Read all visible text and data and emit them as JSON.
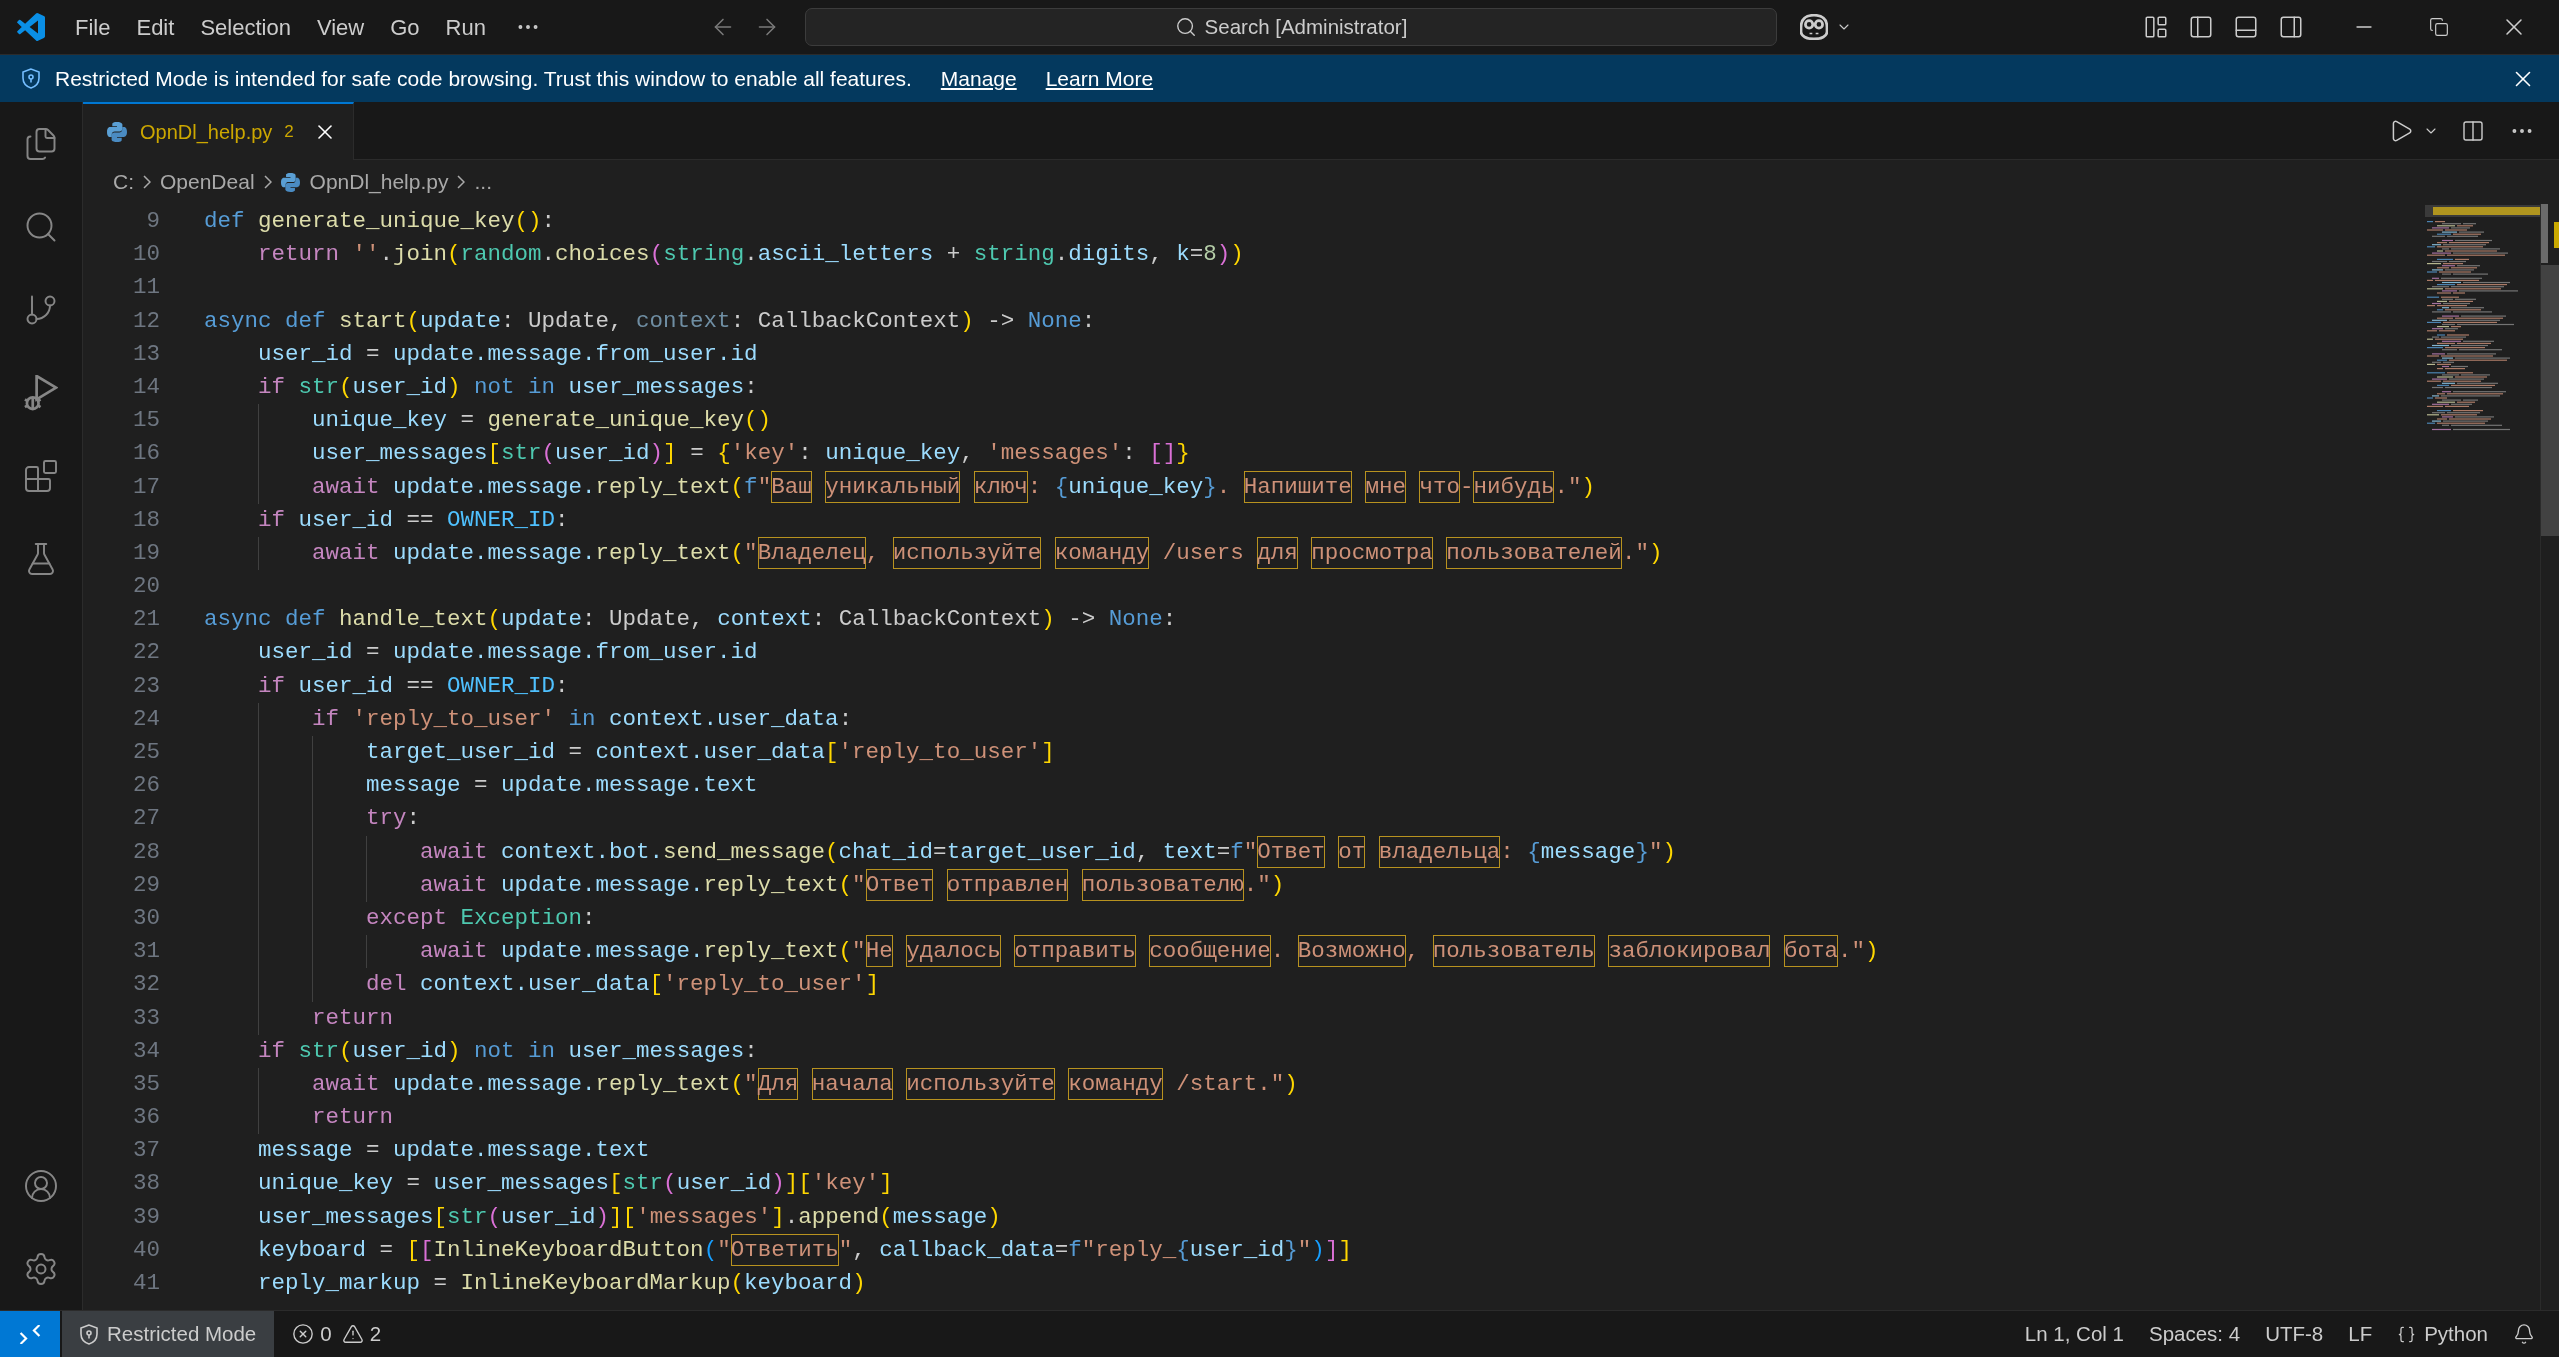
{
  "title_bar": {
    "menu": [
      "File",
      "Edit",
      "Selection",
      "View",
      "Go",
      "Run"
    ],
    "command_center": "Search [Administrator]"
  },
  "banner": {
    "message": "Restricted Mode is intended for safe code browsing. Trust this window to enable all features.",
    "links": [
      "Manage",
      "Learn More"
    ]
  },
  "tabs": [
    {
      "label": "OpnDl_help.py",
      "problems": "2",
      "selected": true
    }
  ],
  "breadcrumb": [
    {
      "label": "C:",
      "kind": "folder"
    },
    {
      "label": "OpenDeal",
      "kind": "folder"
    },
    {
      "label": "OpnDl_help.py",
      "kind": "file"
    },
    {
      "label": "...",
      "kind": "more"
    }
  ],
  "editor": {
    "lines": [
      {
        "number": "9",
        "tokens": [
          {
            "text": "def ",
            "kind": "keyword"
          },
          {
            "text": "generate_unique_key",
            "kind": "function"
          },
          {
            "text": "()",
            "kind": "bracket1"
          },
          {
            "text": ":",
            "kind": "plain"
          }
        ],
        "children": [
          {
            "number": "10",
            "tokens": [
              {
                "text": "return ",
                "kind": "control"
              },
              {
                "text": "''",
                "kind": "string"
              },
              {
                "text": ".",
                "kind": "plain"
              },
              {
                "text": "join",
                "kind": "function"
              },
              {
                "text": "(",
                "kind": "bracket1"
              },
              {
                "text": "random",
                "kind": "class"
              },
              {
                "text": ".",
                "kind": "plain"
              },
              {
                "text": "choices",
                "kind": "function"
              },
              {
                "text": "(",
                "kind": "bracket2"
              },
              {
                "text": "string",
                "kind": "class"
              },
              {
                "text": ".",
                "kind": "plain"
              },
              {
                "text": "ascii_letters",
                "kind": "variable"
              },
              {
                "text": " + ",
                "kind": "plain"
              },
              {
                "text": "string",
                "kind": "class"
              },
              {
                "text": ".",
                "kind": "plain"
              },
              {
                "text": "digits",
                "kind": "variable"
              },
              {
                "text": ", ",
                "kind": "plain"
              },
              {
                "text": "k",
                "kind": "variable"
              },
              {
                "text": "=",
                "kind": "plain"
              },
              {
                "text": "8",
                "kind": "number"
              },
              {
                "text": ")",
                "kind": "bracket2"
              },
              {
                "text": ")",
                "kind": "bracket1"
              }
            ]
          }
        ]
      },
      {
        "number": "11"
      },
      {
        "number": "12",
        "tokens": [
          {
            "text": "async def ",
            "kind": "keyword"
          },
          {
            "text": "start",
            "kind": "function"
          },
          {
            "text": "(",
            "kind": "bracket1"
          },
          {
            "text": "update",
            "kind": "variable"
          },
          {
            "text": ": Update, ",
            "kind": "plain"
          },
          {
            "text": "context",
            "kind": "unused"
          },
          {
            "text": ": CallbackContext",
            "kind": "plain"
          },
          {
            "text": ")",
            "kind": "bracket1"
          },
          {
            "text": " -> ",
            "kind": "plain"
          },
          {
            "text": "None",
            "kind": "keyword"
          },
          {
            "text": ":",
            "kind": "plain"
          }
        ],
        "children": [
          {
            "number": "13",
            "tokens": [
              {
                "text": "user_id",
                "kind": "variable"
              },
              {
                "text": " = ",
                "kind": "plain"
              },
              {
                "text": "update.message.from_user.id",
                "kind": "variable"
              }
            ]
          },
          {
            "number": "14",
            "tokens": [
              {
                "text": "if ",
                "kind": "control"
              },
              {
                "text": "str",
                "kind": "class"
              },
              {
                "text": "(",
                "kind": "bracket1"
              },
              {
                "text": "user_id",
                "kind": "variable"
              },
              {
                "text": ")",
                "kind": "bracket1"
              },
              {
                "text": " not in ",
                "kind": "keyword"
              },
              {
                "text": "user_messages",
                "kind": "variable"
              },
              {
                "text": ":",
                "kind": "plain"
              }
            ],
            "children": [
              {
                "number": "15",
                "tokens": [
                  {
                    "text": "unique_key",
                    "kind": "variable"
                  },
                  {
                    "text": " = ",
                    "kind": "plain"
                  },
                  {
                    "text": "generate_unique_key",
                    "kind": "function"
                  },
                  {
                    "text": "()",
                    "kind": "bracket1"
                  }
                ]
              },
              {
                "number": "16",
                "tokens": [
                  {
                    "text": "user_messages",
                    "kind": "variable"
                  },
                  {
                    "text": "[",
                    "kind": "bracket1"
                  },
                  {
                    "text": "str",
                    "kind": "class"
                  },
                  {
                    "text": "(",
                    "kind": "bracket2"
                  },
                  {
                    "text": "user_id",
                    "kind": "variable"
                  },
                  {
                    "text": ")",
                    "kind": "bracket2"
                  },
                  {
                    "text": "]",
                    "kind": "bracket1"
                  },
                  {
                    "text": " = ",
                    "kind": "plain"
                  },
                  {
                    "text": "{",
                    "kind": "bracket1"
                  },
                  {
                    "text": "'key'",
                    "kind": "string"
                  },
                  {
                    "text": ": ",
                    "kind": "plain"
                  },
                  {
                    "text": "unique_key",
                    "kind": "variable"
                  },
                  {
                    "text": ", ",
                    "kind": "plain"
                  },
                  {
                    "text": "'messages'",
                    "kind": "string"
                  },
                  {
                    "text": ": ",
                    "kind": "plain"
                  },
                  {
                    "text": "[]",
                    "kind": "bracket2"
                  },
                  {
                    "text": "}",
                    "kind": "bracket1"
                  }
                ]
              },
              {
                "number": "17",
                "tokens": [
                  {
                    "text": "await ",
                    "kind": "control"
                  },
                  {
                    "text": "update.message.",
                    "kind": "variable"
                  },
                  {
                    "text": "reply_text",
                    "kind": "function"
                  },
                  {
                    "text": "(",
                    "kind": "bracket1"
                  },
                  {
                    "text": "f",
                    "kind": "keyword"
                  },
                  {
                    "text": "\"",
                    "kind": "string"
                  },
                  {
                    "text": "Ваш уникальный ключ",
                    "kind": "flagged"
                  },
                  {
                    "text": ": ",
                    "kind": "string"
                  },
                  {
                    "text": "{",
                    "kind": "keyword"
                  },
                  {
                    "text": "unique_key",
                    "kind": "variable"
                  },
                  {
                    "text": "}",
                    "kind": "keyword"
                  },
                  {
                    "text": ". ",
                    "kind": "string"
                  },
                  {
                    "text": "Напишите мне что",
                    "kind": "flagged"
                  },
                  {
                    "text": "-",
                    "kind": "string"
                  },
                  {
                    "text": "нибудь",
                    "kind": "flagged"
                  },
                  {
                    "text": ".\"",
                    "kind": "string"
                  },
                  {
                    "text": ")",
                    "kind": "bracket1"
                  }
                ]
              }
            ]
          },
          {
            "number": "18",
            "tokens": [
              {
                "text": "if ",
                "kind": "control"
              },
              {
                "text": "user_id",
                "kind": "variable"
              },
              {
                "text": " == ",
                "kind": "plain"
              },
              {
                "text": "OWNER_ID",
                "kind": "constant"
              },
              {
                "text": ":",
                "kind": "plain"
              }
            ],
            "children": [
              {
                "number": "19",
                "tokens": [
                  {
                    "text": "await ",
                    "kind": "control"
                  },
                  {
                    "text": "update.message.",
                    "kind": "variable"
                  },
                  {
                    "text": "reply_text",
                    "kind": "function"
                  },
                  {
                    "text": "(",
                    "kind": "bracket1"
                  },
                  {
                    "text": "\"",
                    "kind": "string"
                  },
                  {
                    "text": "Владелец",
                    "kind": "flagged"
                  },
                  {
                    "text": ", ",
                    "kind": "string"
                  },
                  {
                    "text": "используйте команду",
                    "kind": "flagged"
                  },
                  {
                    "text": " /users ",
                    "kind": "string"
                  },
                  {
                    "text": "для просмотра пользователей",
                    "kind": "flagged"
                  },
                  {
                    "text": ".\"",
                    "kind": "string"
                  },
                  {
                    "text": ")",
                    "kind": "bracket1"
                  }
                ]
              }
            ]
          }
        ]
      },
      {
        "number": "20"
      },
      {
        "number": "21",
        "tokens": [
          {
            "text": "async def ",
            "kind": "keyword"
          },
          {
            "text": "handle_text",
            "kind": "function"
          },
          {
            "text": "(",
            "kind": "bracket1"
          },
          {
            "text": "update",
            "kind": "variable"
          },
          {
            "text": ": Update, ",
            "kind": "plain"
          },
          {
            "text": "context",
            "kind": "variable"
          },
          {
            "text": ": CallbackContext",
            "kind": "plain"
          },
          {
            "text": ")",
            "kind": "bracket1"
          },
          {
            "text": " -> ",
            "kind": "plain"
          },
          {
            "text": "None",
            "kind": "keyword"
          },
          {
            "text": ":",
            "kind": "plain"
          }
        ],
        "children": [
          {
            "number": "22",
            "tokens": [
              {
                "text": "user_id",
                "kind": "variable"
              },
              {
                "text": " = ",
                "kind": "plain"
              },
              {
                "text": "update.message.from_user.id",
                "kind": "variable"
              }
            ]
          },
          {
            "number": "23",
            "tokens": [
              {
                "text": "if ",
                "kind": "control"
              },
              {
                "text": "user_id",
                "kind": "variable"
              },
              {
                "text": " == ",
                "kind": "plain"
              },
              {
                "text": "OWNER_ID",
                "kind": "constant"
              },
              {
                "text": ":",
                "kind": "plain"
              }
            ],
            "children": [
              {
                "number": "24",
                "tokens": [
                  {
                    "text": "if ",
                    "kind": "control"
                  },
                  {
                    "text": "'reply_to_user'",
                    "kind": "string"
                  },
                  {
                    "text": " in ",
                    "kind": "keyword"
                  },
                  {
                    "text": "context.user_data",
                    "kind": "variable"
                  },
                  {
                    "text": ":",
                    "kind": "plain"
                  }
                ],
                "children": [
                  {
                    "number": "25",
                    "tokens": [
                      {
                        "text": "target_user_id",
                        "kind": "variable"
                      },
                      {
                        "text": " = ",
                        "kind": "plain"
                      },
                      {
                        "text": "context.user_data",
                        "kind": "variable"
                      },
                      {
                        "text": "[",
                        "kind": "bracket1"
                      },
                      {
                        "text": "'reply_to_user'",
                        "kind": "string"
                      },
                      {
                        "text": "]",
                        "kind": "bracket1"
                      }
                    ]
                  },
                  {
                    "number": "26",
                    "tokens": [
                      {
                        "text": "message",
                        "kind": "variable"
                      },
                      {
                        "text": " = ",
                        "kind": "plain"
                      },
                      {
                        "text": "update.message.text",
                        "kind": "variable"
                      }
                    ]
                  },
                  {
                    "number": "27",
                    "tokens": [
                      {
                        "text": "try",
                        "kind": "control"
                      },
                      {
                        "text": ":",
                        "kind": "plain"
                      }
                    ],
                    "children": [
                      {
                        "number": "28",
                        "tokens": [
                          {
                            "text": "await ",
                            "kind": "control"
                          },
                          {
                            "text": "context.bot.",
                            "kind": "variable"
                          },
                          {
                            "text": "send_message",
                            "kind": "function"
                          },
                          {
                            "text": "(",
                            "kind": "bracket1"
                          },
                          {
                            "text": "chat_id",
                            "kind": "variable"
                          },
                          {
                            "text": "=",
                            "kind": "plain"
                          },
                          {
                            "text": "target_user_id",
                            "kind": "variable"
                          },
                          {
                            "text": ", ",
                            "kind": "plain"
                          },
                          {
                            "text": "text",
                            "kind": "variable"
                          },
                          {
                            "text": "=",
                            "kind": "plain"
                          },
                          {
                            "text": "f",
                            "kind": "keyword"
                          },
                          {
                            "text": "\"",
                            "kind": "string"
                          },
                          {
                            "text": "Ответ от владельца",
                            "kind": "flagged"
                          },
                          {
                            "text": ": ",
                            "kind": "string"
                          },
                          {
                            "text": "{",
                            "kind": "keyword"
                          },
                          {
                            "text": "message",
                            "kind": "variable"
                          },
                          {
                            "text": "}",
                            "kind": "keyword"
                          },
                          {
                            "text": "\"",
                            "kind": "string"
                          },
                          {
                            "text": ")",
                            "kind": "bracket1"
                          }
                        ]
                      },
                      {
                        "number": "29",
                        "tokens": [
                          {
                            "text": "await ",
                            "kind": "control"
                          },
                          {
                            "text": "update.message.",
                            "kind": "variable"
                          },
                          {
                            "text": "reply_text",
                            "kind": "function"
                          },
                          {
                            "text": "(",
                            "kind": "bracket1"
                          },
                          {
                            "text": "\"",
                            "kind": "string"
                          },
                          {
                            "text": "Ответ отправлен пользователю",
                            "kind": "flagged"
                          },
                          {
                            "text": ".\"",
                            "kind": "string"
                          },
                          {
                            "text": ")",
                            "kind": "bracket1"
                          }
                        ]
                      }
                    ]
                  },
                  {
                    "number": "30",
                    "tokens": [
                      {
                        "text": "except ",
                        "kind": "control"
                      },
                      {
                        "text": "Exception",
                        "kind": "class"
                      },
                      {
                        "text": ":",
                        "kind": "plain"
                      }
                    ],
                    "children": [
                      {
                        "number": "31",
                        "tokens": [
                          {
                            "text": "await ",
                            "kind": "control"
                          },
                          {
                            "text": "update.message.",
                            "kind": "variable"
                          },
                          {
                            "text": "reply_text",
                            "kind": "function"
                          },
                          {
                            "text": "(",
                            "kind": "bracket1"
                          },
                          {
                            "text": "\"",
                            "kind": "string"
                          },
                          {
                            "text": "Не удалось отправить сообщение",
                            "kind": "flagged"
                          },
                          {
                            "text": ". ",
                            "kind": "string"
                          },
                          {
                            "text": "Возможно",
                            "kind": "flagged"
                          },
                          {
                            "text": ", ",
                            "kind": "string"
                          },
                          {
                            "text": "пользователь заблокировал бота",
                            "kind": "flagged"
                          },
                          {
                            "text": ".\"",
                            "kind": "string"
                          },
                          {
                            "text": ")",
                            "kind": "bracket1"
                          }
                        ]
                      }
                    ]
                  },
                  {
                    "number": "32",
                    "tokens": [
                      {
                        "text": "del ",
                        "kind": "control"
                      },
                      {
                        "text": "context.user_data",
                        "kind": "variable"
                      },
                      {
                        "text": "[",
                        "kind": "bracket1"
                      },
                      {
                        "text": "'reply_to_user'",
                        "kind": "string"
                      },
                      {
                        "text": "]",
                        "kind": "bracket1"
                      }
                    ]
                  }
                ]
              },
              {
                "number": "33",
                "tokens": [
                  {
                    "text": "return",
                    "kind": "control"
                  }
                ]
              }
            ]
          },
          {
            "number": "34",
            "tokens": [
              {
                "text": "if ",
                "kind": "control"
              },
              {
                "text": "str",
                "kind": "class"
              },
              {
                "text": "(",
                "kind": "bracket1"
              },
              {
                "text": "user_id",
                "kind": "variable"
              },
              {
                "text": ")",
                "kind": "bracket1"
              },
              {
                "text": " not in ",
                "kind": "keyword"
              },
              {
                "text": "user_messages",
                "kind": "variable"
              },
              {
                "text": ":",
                "kind": "plain"
              }
            ],
            "children": [
              {
                "number": "35",
                "tokens": [
                  {
                    "text": "await ",
                    "kind": "control"
                  },
                  {
                    "text": "update.message.",
                    "kind": "variable"
                  },
                  {
                    "text": "reply_text",
                    "kind": "function"
                  },
                  {
                    "text": "(",
                    "kind": "bracket1"
                  },
                  {
                    "text": "\"",
                    "kind": "string"
                  },
                  {
                    "text": "Для начала используйте команду",
                    "kind": "flagged"
                  },
                  {
                    "text": " /start.\"",
                    "kind": "string"
                  },
                  {
                    "text": ")",
                    "kind": "bracket1"
                  }
                ]
              },
              {
                "number": "36",
                "tokens": [
                  {
                    "text": "return",
                    "kind": "control"
                  }
                ]
              }
            ]
          },
          {
            "number": "37",
            "tokens": [
              {
                "text": "message",
                "kind": "variable"
              },
              {
                "text": " = ",
                "kind": "plain"
              },
              {
                "text": "update.message.text",
                "kind": "variable"
              }
            ]
          },
          {
            "number": "38",
            "tokens": [
              {
                "text": "unique_key",
                "kind": "variable"
              },
              {
                "text": " = ",
                "kind": "plain"
              },
              {
                "text": "user_messages",
                "kind": "variable"
              },
              {
                "text": "[",
                "kind": "bracket1"
              },
              {
                "text": "str",
                "kind": "class"
              },
              {
                "text": "(",
                "kind": "bracket2"
              },
              {
                "text": "user_id",
                "kind": "variable"
              },
              {
                "text": ")",
                "kind": "bracket2"
              },
              {
                "text": "][",
                "kind": "bracket1"
              },
              {
                "text": "'key'",
                "kind": "string"
              },
              {
                "text": "]",
                "kind": "bracket1"
              }
            ]
          },
          {
            "number": "39",
            "tokens": [
              {
                "text": "user_messages",
                "kind": "variable"
              },
              {
                "text": "[",
                "kind": "bracket1"
              },
              {
                "text": "str",
                "kind": "class"
              },
              {
                "text": "(",
                "kind": "bracket2"
              },
              {
                "text": "user_id",
                "kind": "variable"
              },
              {
                "text": ")",
                "kind": "bracket2"
              },
              {
                "text": "][",
                "kind": "bracket1"
              },
              {
                "text": "'messages'",
                "kind": "string"
              },
              {
                "text": "]",
                "kind": "bracket1"
              },
              {
                "text": ".",
                "kind": "plain"
              },
              {
                "text": "append",
                "kind": "function"
              },
              {
                "text": "(",
                "kind": "bracket1"
              },
              {
                "text": "message",
                "kind": "variable"
              },
              {
                "text": ")",
                "kind": "bracket1"
              }
            ]
          },
          {
            "number": "40",
            "tokens": [
              {
                "text": "keyboard",
                "kind": "variable"
              },
              {
                "text": " = ",
                "kind": "plain"
              },
              {
                "text": "[",
                "kind": "bracket1"
              },
              {
                "text": "[",
                "kind": "bracket2"
              },
              {
                "text": "InlineKeyboardButton",
                "kind": "function"
              },
              {
                "text": "(",
                "kind": "bracket3"
              },
              {
                "text": "\"",
                "kind": "string"
              },
              {
                "text": "Ответить",
                "kind": "flagged"
              },
              {
                "text": "\"",
                "kind": "string"
              },
              {
                "text": ", ",
                "kind": "plain"
              },
              {
                "text": "callback_data",
                "kind": "variable"
              },
              {
                "text": "=",
                "kind": "plain"
              },
              {
                "text": "f",
                "kind": "keyword"
              },
              {
                "text": "\"reply_",
                "kind": "string"
              },
              {
                "text": "{",
                "kind": "keyword"
              },
              {
                "text": "user_id",
                "kind": "variable"
              },
              {
                "text": "}",
                "kind": "keyword"
              },
              {
                "text": "\"",
                "kind": "string"
              },
              {
                "text": ")",
                "kind": "bracket3"
              },
              {
                "text": "]",
                "kind": "bracket2"
              },
              {
                "text": "]",
                "kind": "bracket1"
              }
            ]
          },
          {
            "number": "41",
            "tokens": [
              {
                "text": "reply_markup",
                "kind": "variable"
              },
              {
                "text": " = ",
                "kind": "plain"
              },
              {
                "text": "InlineKeyboardMarkup",
                "kind": "function"
              },
              {
                "text": "(",
                "kind": "bracket1"
              },
              {
                "text": "keyboard",
                "kind": "variable"
              },
              {
                "text": ")",
                "kind": "bracket1"
              }
            ]
          }
        ]
      }
    ]
  },
  "status_bar": {
    "mode": "Restricted Mode",
    "errors": "0",
    "warnings": "2",
    "position": "Ln 1, Col 1",
    "indentation": "Spaces: 4",
    "encoding": "UTF-8",
    "line_ending": "LF",
    "language": "Python"
  }
}
